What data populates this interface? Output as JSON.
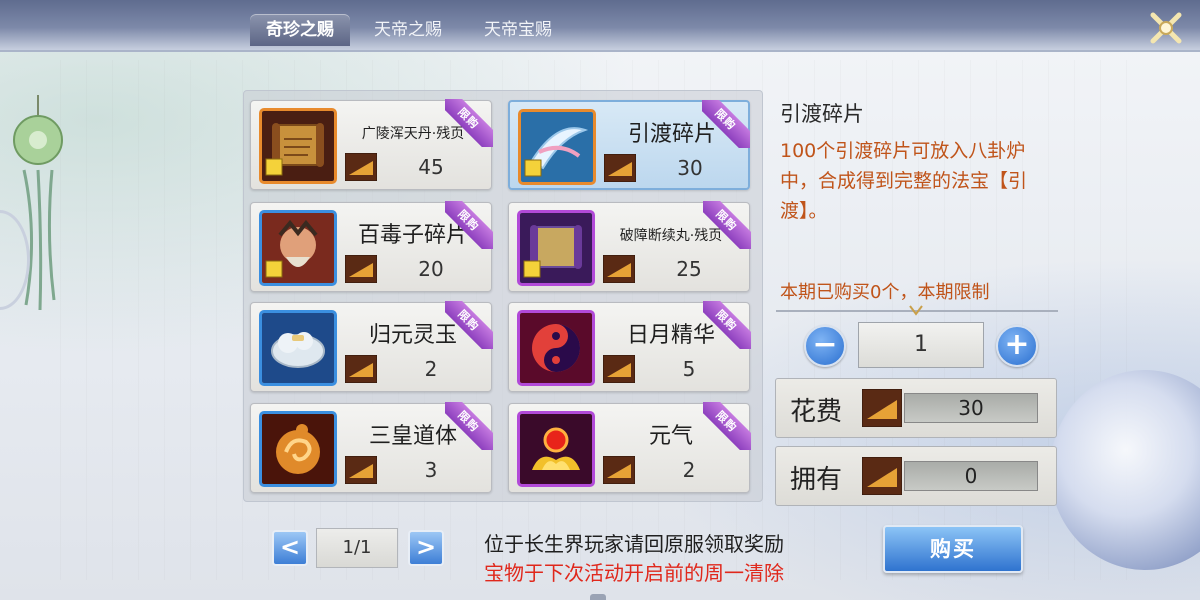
{
  "tabs": [
    {
      "label": "奇珍之赐",
      "active": true
    },
    {
      "label": "天帝之赐",
      "active": false
    },
    {
      "label": "天帝宝赐",
      "active": false
    }
  ],
  "ribbon_label": "限购",
  "items": [
    {
      "name": "广陵浑天丹·残页",
      "price": "45",
      "icon": "scroll-fragment-icon",
      "border": "orange",
      "selected": false
    },
    {
      "name": "引渡碎片",
      "price": "30",
      "icon": "blade-fragment-icon",
      "border": "orange",
      "selected": true
    },
    {
      "name": "百毒子碎片",
      "price": "20",
      "icon": "warrior-portrait-icon",
      "border": "blue",
      "selected": false
    },
    {
      "name": "破障断续丸·残页",
      "price": "25",
      "icon": "purple-scroll-fragment-icon",
      "border": "purple",
      "selected": false
    },
    {
      "name": "归元灵玉",
      "price": "2",
      "icon": "jade-cloud-icon",
      "border": "blue",
      "selected": false
    },
    {
      "name": "日月精华",
      "price": "5",
      "icon": "sun-moon-orb-icon",
      "border": "purple",
      "selected": false
    },
    {
      "name": "三皇道体",
      "price": "3",
      "icon": "golden-swirl-icon",
      "border": "blue",
      "selected": false
    },
    {
      "name": "元气",
      "price": "2",
      "icon": "lotus-flame-icon",
      "border": "purple",
      "selected": false
    }
  ],
  "detail": {
    "title": "引渡碎片",
    "description": "100个引渡碎片可放入八卦炉中，合成得到完整的法宝【引渡】。",
    "purchase_limit": "本期已购买0个，本期限制"
  },
  "quantity": {
    "minus": "−",
    "value": "1",
    "plus": "+"
  },
  "cost": {
    "label": "花费",
    "value": "30"
  },
  "owned": {
    "label": "拥有",
    "value": "0"
  },
  "pagination": {
    "prev": "<",
    "page": "1/1",
    "next": ">"
  },
  "notices": {
    "line1": "位于长生界玩家请回原服领取奖励",
    "line2": "宝物于下次活动开启前的周一清除"
  },
  "buy_label": "购买",
  "colors": {
    "accent_orange": "#c0541a",
    "notice_red": "#e0281c",
    "button_blue": "#2f73cf",
    "ribbon_purple": "#8d3fbe"
  }
}
